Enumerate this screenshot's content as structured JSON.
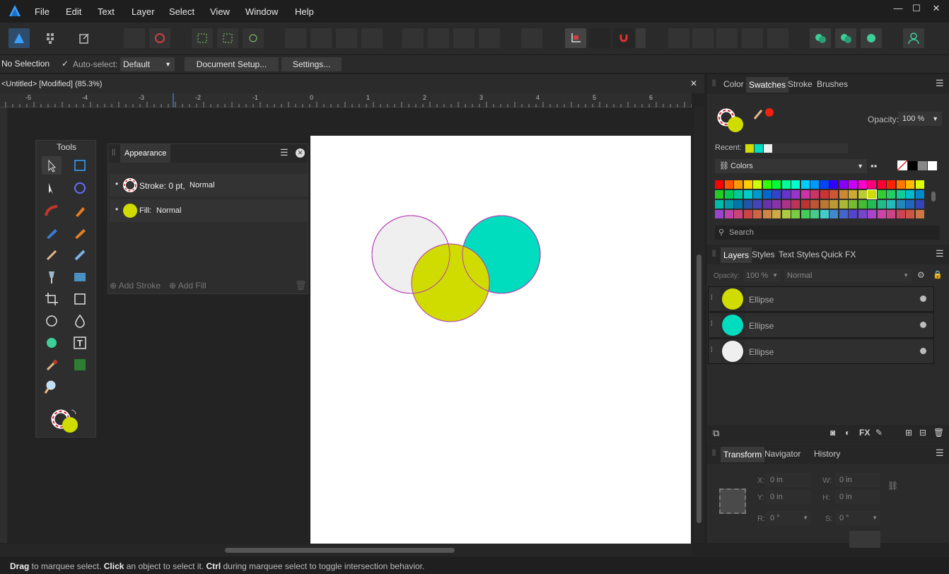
{
  "menubar": {
    "items": [
      "File",
      "Edit",
      "Text",
      "Layer",
      "Select",
      "View",
      "Window",
      "Help"
    ]
  },
  "contextbar": {
    "selection": "No Selection",
    "autoselect_label": "Auto-select:",
    "autoselect_value": "Default",
    "document_setup": "Document Setup...",
    "settings": "Settings..."
  },
  "document": {
    "tab_title": "<Untitled> [Modified] (85.3%)"
  },
  "ruler": {
    "labels": [
      "-5",
      "-4",
      "-3",
      "-2",
      "-1",
      "0",
      "1",
      "2",
      "3",
      "4",
      "5",
      "6"
    ]
  },
  "tools": {
    "title": "Tools"
  },
  "appearance": {
    "title": "Appearance",
    "stroke_label": "Stroke: 0 pt,",
    "stroke_blend": "Normal",
    "fill_label": "Fill:",
    "fill_blend": "Normal",
    "add_stroke": "Add Stroke",
    "add_fill": "Add Fill"
  },
  "swatches_panel": {
    "tabs": [
      "Color",
      "Swatches",
      "Stroke",
      "Brushes"
    ],
    "opacity_label": "Opacity:",
    "opacity_value": "100 %",
    "recent_label": "Recent:",
    "palette_name": "Colors",
    "search_placeholder": "Search"
  },
  "layers_panel": {
    "tabs": [
      "Layers",
      "Styles",
      "Text Styles",
      "Quick FX"
    ],
    "opacity_label": "Opacity:",
    "opacity_value": "100 %",
    "blend_mode": "Normal",
    "layers": [
      {
        "name": "Ellipse",
        "color": "#d0dc00"
      },
      {
        "name": "Ellipse",
        "color": "#00dcbe"
      },
      {
        "name": "Ellipse",
        "color": "#efefef"
      }
    ]
  },
  "transform_panel": {
    "tabs": [
      "Transform",
      "Navigator",
      "History"
    ],
    "x_label": "X:",
    "x_value": "0 in",
    "y_label": "Y:",
    "y_value": "0 in",
    "w_label": "W:",
    "w_value": "0 in",
    "h_label": "H:",
    "h_value": "0 in",
    "r_label": "R:",
    "r_value": "0 °",
    "s_label": "S:",
    "s_value": "0 °"
  },
  "status": {
    "b1": "Drag",
    "t1": " to marquee select. ",
    "b2": "Click",
    "t2": " an object to select it. ",
    "b3": "Ctrl",
    "t3": " during marquee select to toggle intersection behavior."
  },
  "colors": {
    "accent": "#3aa0ff",
    "fill": "#d0dc00",
    "teal": "#00dcbe",
    "gray_circle": "#efefef",
    "stroke": "#b43cb4"
  }
}
